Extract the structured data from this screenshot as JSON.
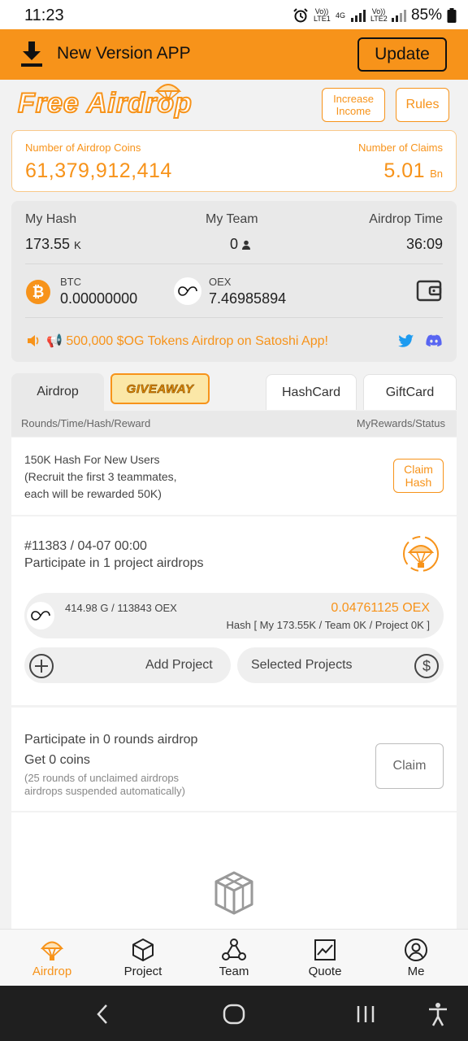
{
  "status_bar": {
    "time": "11:23",
    "net1": "Vo)) LTE1",
    "net2": "Vo)) LTE2",
    "gen": "4G",
    "battery": "85%"
  },
  "banner": {
    "title": "New Version APP",
    "update_label": "Update"
  },
  "header": {
    "logo_text": "Free Airdrop",
    "increase_income_line1": "Increase",
    "increase_income_line2": "Income",
    "rules_label": "Rules"
  },
  "coins_card": {
    "airdrop_coins_label": "Number of Airdrop Coins",
    "airdrop_coins_value": "61,379,912,414",
    "claims_label": "Number of Claims",
    "claims_value": "5.01",
    "claims_unit": "Bn"
  },
  "stats": {
    "my_hash_label": "My Hash",
    "my_hash_value": "173.55",
    "my_hash_unit": "K",
    "my_team_label": "My Team",
    "my_team_value": "0",
    "airdrop_time_label": "Airdrop Time",
    "airdrop_time_value": "36:09"
  },
  "wallet": {
    "btc_label": "BTC",
    "btc_value": "0.00000000",
    "oex_label": "OEX",
    "oex_value": "7.46985894"
  },
  "announcement": "📢 500,000 $OG Tokens Airdrop on Satoshi App!",
  "tabs": {
    "airdrop": "Airdrop",
    "giveaway": "GIVEAWAY",
    "hashcard": "HashCard",
    "giftcard": "GiftCard"
  },
  "table_head": {
    "left": "Rounds/Time/Hash/Reward",
    "right": "MyRewards/Status"
  },
  "new_user": {
    "line1": "150K Hash For New Users",
    "line2": "(Recruit the first 3 teammates,",
    "line3": "each will be rewarded 50K)",
    "claim_line1": "Claim",
    "claim_line2": "Hash"
  },
  "round": {
    "id": "#11383 / 04-07 00:00",
    "participate": "Participate in 1 project airdrops",
    "pool": "414.98 G / 113843 OEX",
    "reward": "0.04761125 OEX",
    "hash_detail": "Hash [ My 173.55K / Team 0K / Project 0K ]",
    "add_project": "Add Project",
    "selected_projects": "Selected Projects"
  },
  "unclaimed": {
    "line1": "Participate in 0 rounds airdrop",
    "line2": "Get 0 coins",
    "note1": "(25 rounds of unclaimed airdrops",
    "note2": "airdrops suspended automatically)",
    "claim_label": "Claim"
  },
  "bottom_nav": {
    "airdrop": "Airdrop",
    "project": "Project",
    "team": "Team",
    "quote": "Quote",
    "me": "Me"
  },
  "colors": {
    "accent": "#f7931a",
    "twitter": "#1d9bf0",
    "discord": "#5865f2"
  }
}
